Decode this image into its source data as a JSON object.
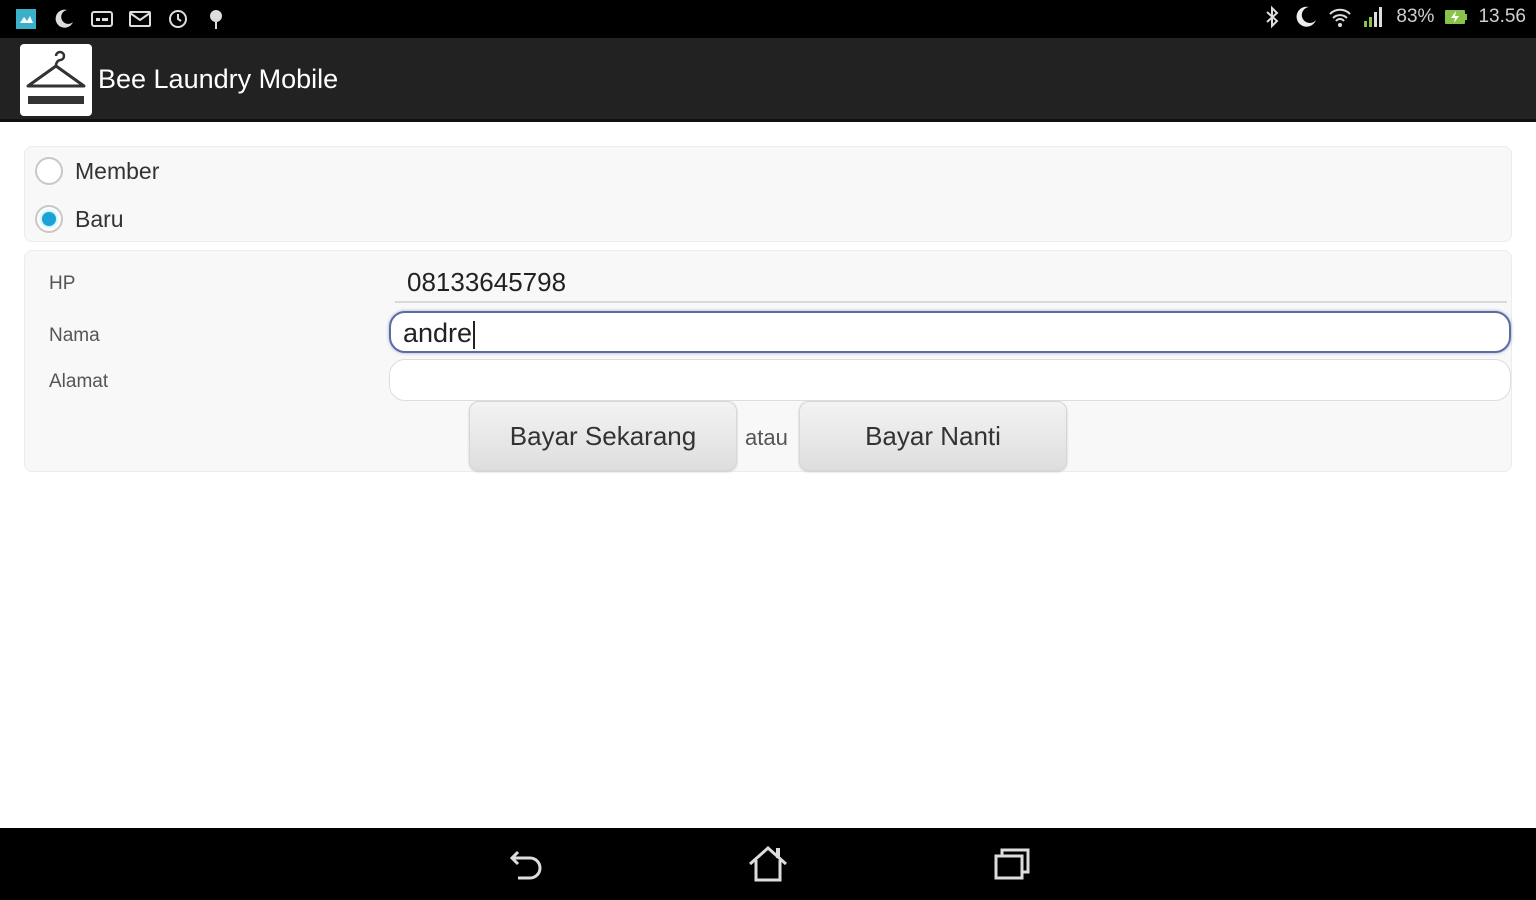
{
  "status_bar": {
    "left_icons": [
      "app-notification-icon",
      "moon-icon",
      "message-icon",
      "mail-icon",
      "sync-icon",
      "pin-icon"
    ],
    "right_icons": [
      "bluetooth-icon",
      "moon-icon",
      "wifi-icon",
      "signal-icon",
      "battery-charging-icon"
    ],
    "battery_percent": "83%",
    "time": "13.56",
    "battery_color": "#8bc34a"
  },
  "action_bar": {
    "title": "Bee Laundry Mobile",
    "logo_icon": "hanger-logo-icon"
  },
  "customer_type": {
    "options": [
      {
        "label": "Member",
        "checked": false
      },
      {
        "label": "Baru",
        "checked": true
      }
    ],
    "accent_color": "#1aa3d4"
  },
  "form": {
    "hp_label": "HP",
    "hp_value": "08133645798",
    "nama_label": "Nama",
    "nama_value": "andre",
    "alamat_label": "Alamat",
    "alamat_value": "",
    "pay_now_label": "Bayar Sekarang",
    "or_label": "atau",
    "pay_later_label": "Bayar Nanti"
  },
  "nav_bar": {
    "buttons": [
      "back-icon",
      "home-icon",
      "recents-icon"
    ]
  }
}
